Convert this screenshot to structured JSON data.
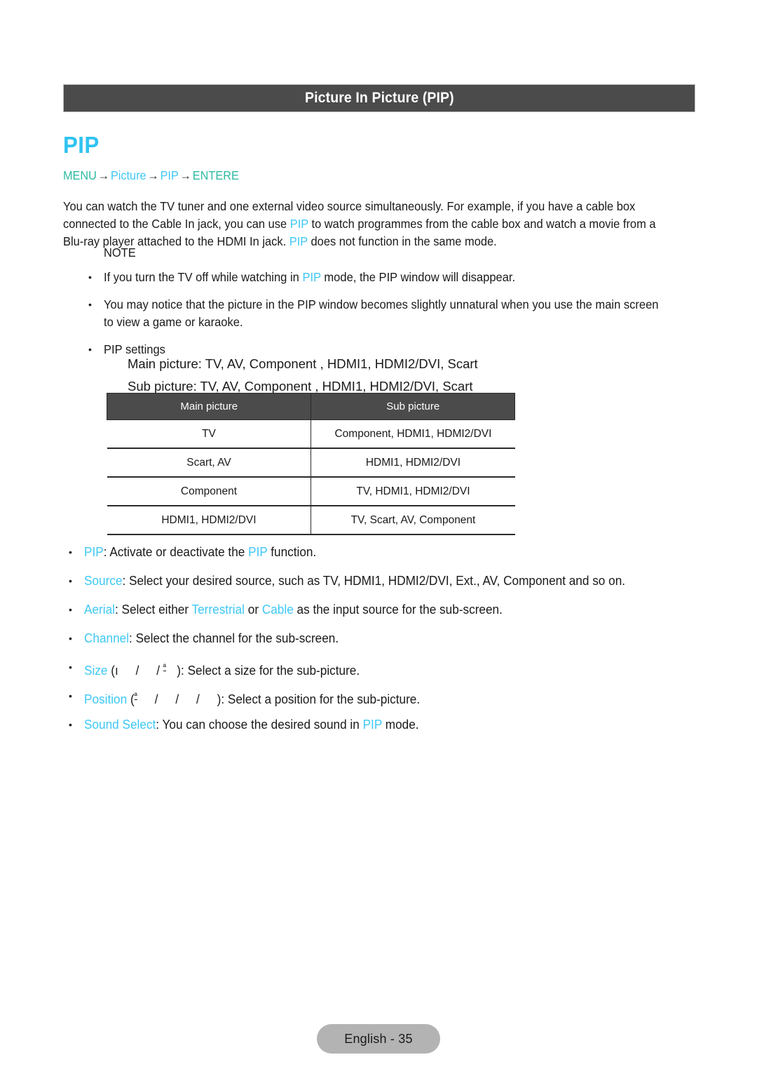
{
  "header": {
    "title": "Picture In Picture (PIP)"
  },
  "heading": {
    "text": "PIP"
  },
  "menu_path": {
    "menu": "MENU",
    "arrow": "→",
    "picture": "Picture",
    "pip": "PIP",
    "enter": "ENTERE"
  },
  "intro": {
    "part1": "You can watch the TV tuner and one external video source simultaneously. For example, if you have a cable box connected to the Cable In jack, you can use ",
    "pip1": "PIP",
    "part2": " to watch programmes from the cable box and watch a movie from a Blu-ray player attached to the HDMI In jack. ",
    "pip2": "PIP",
    "part3": " does not function in the same mode."
  },
  "note": {
    "label": "NOTE",
    "bullet_glyph": "•",
    "items": [
      {
        "pre": "If you turn the TV off while watching in ",
        "highlight": "PIP",
        "post": " mode, the PIP window will disappear."
      },
      {
        "pre": "You may notice that the picture in the PIP window becomes slightly unnatural when you use the main screen to view a game or karaoke.",
        "highlight": "",
        "post": ""
      },
      {
        "pre": "PIP settings",
        "highlight": "",
        "post": ""
      }
    ]
  },
  "settings_lines": {
    "main": "Main picture: TV, AV, Component , HDMI1, HDMI2/DVI, Scart",
    "sub": "Sub picture: TV, AV, Component , HDMI1, HDMI2/DVI, Scart"
  },
  "table": {
    "headers": [
      "Main picture",
      "Sub picture"
    ],
    "rows": [
      [
        "TV",
        "Component, HDMI1, HDMI2/DVI"
      ],
      [
        "Scart, AV",
        "HDMI1, HDMI2/DVI"
      ],
      [
        "Component",
        "TV, HDMI1, HDMI2/DVI"
      ],
      [
        "HDMI1, HDMI2/DVI",
        "TV, Scart, AV, Component"
      ]
    ]
  },
  "options": {
    "bullet_glyph": "•",
    "pip": {
      "term": "PIP",
      "mid": ": Activate or deactivate the ",
      "highlight": "PIP",
      "post": " function."
    },
    "source": {
      "term": "Source",
      "rest": ": Select your desired source, such as TV, HDMI1, HDMI2/DVI, Ext., AV, Component  and so on."
    },
    "aerial": {
      "term": "Aerial",
      "mid1": ": Select either ",
      "opt1": "Terrestrial",
      "mid2": " or ",
      "opt2": "Cable",
      "post": " as the input source for the sub-screen."
    },
    "channel": {
      "term": "Channel",
      "rest": ": Select the channel for the sub-screen."
    },
    "size": {
      "term": "Size",
      "paren_open": "(",
      "sym1": "ı",
      "slash": "/",
      "sym3": "ª",
      "paren_close": ")",
      "rest": ": Select a size for the sub-picture."
    },
    "position": {
      "term": "Position",
      "paren_open": "(",
      "sym1": "ª",
      "slash": "/",
      "paren_close": ")",
      "rest": ": Select a position for the sub-picture."
    },
    "sound_select": {
      "term": "Sound Select",
      "mid": ": You can choose the desired sound in ",
      "highlight": "PIP",
      "post": " mode."
    }
  },
  "footer": {
    "label": "English - 35"
  },
  "colors": {
    "accent_blue": "#3ec8f4",
    "accent_green": "#2fbba2",
    "header_bg": "#4b4b4b",
    "footer_bg": "#b3b3b3"
  }
}
